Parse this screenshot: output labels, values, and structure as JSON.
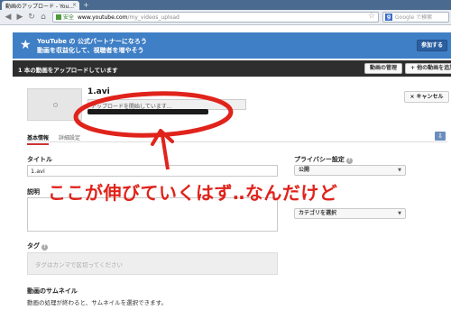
{
  "browser": {
    "tab_title": "動画のアップロード - You...",
    "tab_close": "×",
    "new_tab": "+",
    "secure_label": "安全",
    "url_host": "www.youtube.com",
    "url_path": "/my_videos_upload",
    "search_engine_letter": "g",
    "search_placeholder": "Google で検索"
  },
  "partner_banner": {
    "line1": "YouTube の 公式パートナーになろう",
    "line2": "動画を収益化して、視聴者を増やそう",
    "join_label": "参加する",
    "color": "#3f7fc5"
  },
  "upload_header": {
    "title": "1 本の動画をアップロードしています",
    "manage_label": "動画の管理",
    "more_label": "+ 他の動画を追加"
  },
  "upload": {
    "filename": "1.avi",
    "status": "アップロードを開始しています...",
    "progress_fraction": 0.0,
    "cancel_label": "× キャンセル"
  },
  "tabs": {
    "basic": "基本情報",
    "advanced": "詳細設定"
  },
  "form": {
    "title_label": "タイトル",
    "title_value": "1.avi",
    "description_label": "説明",
    "tags_label": "タグ",
    "tags_placeholder": "タグはカンマで区切ってください",
    "thumbnail_label": "動画のサムネイル",
    "thumbnail_note": "動画の処理が終わると、サムネイルを選択できます。",
    "privacy_label": "プライバシー設定",
    "privacy_value": "公開",
    "category_value": "カテゴリを選択"
  },
  "annotation": {
    "text": "ここが伸びていくはず‥なんだけど",
    "color": "#e0231b"
  }
}
